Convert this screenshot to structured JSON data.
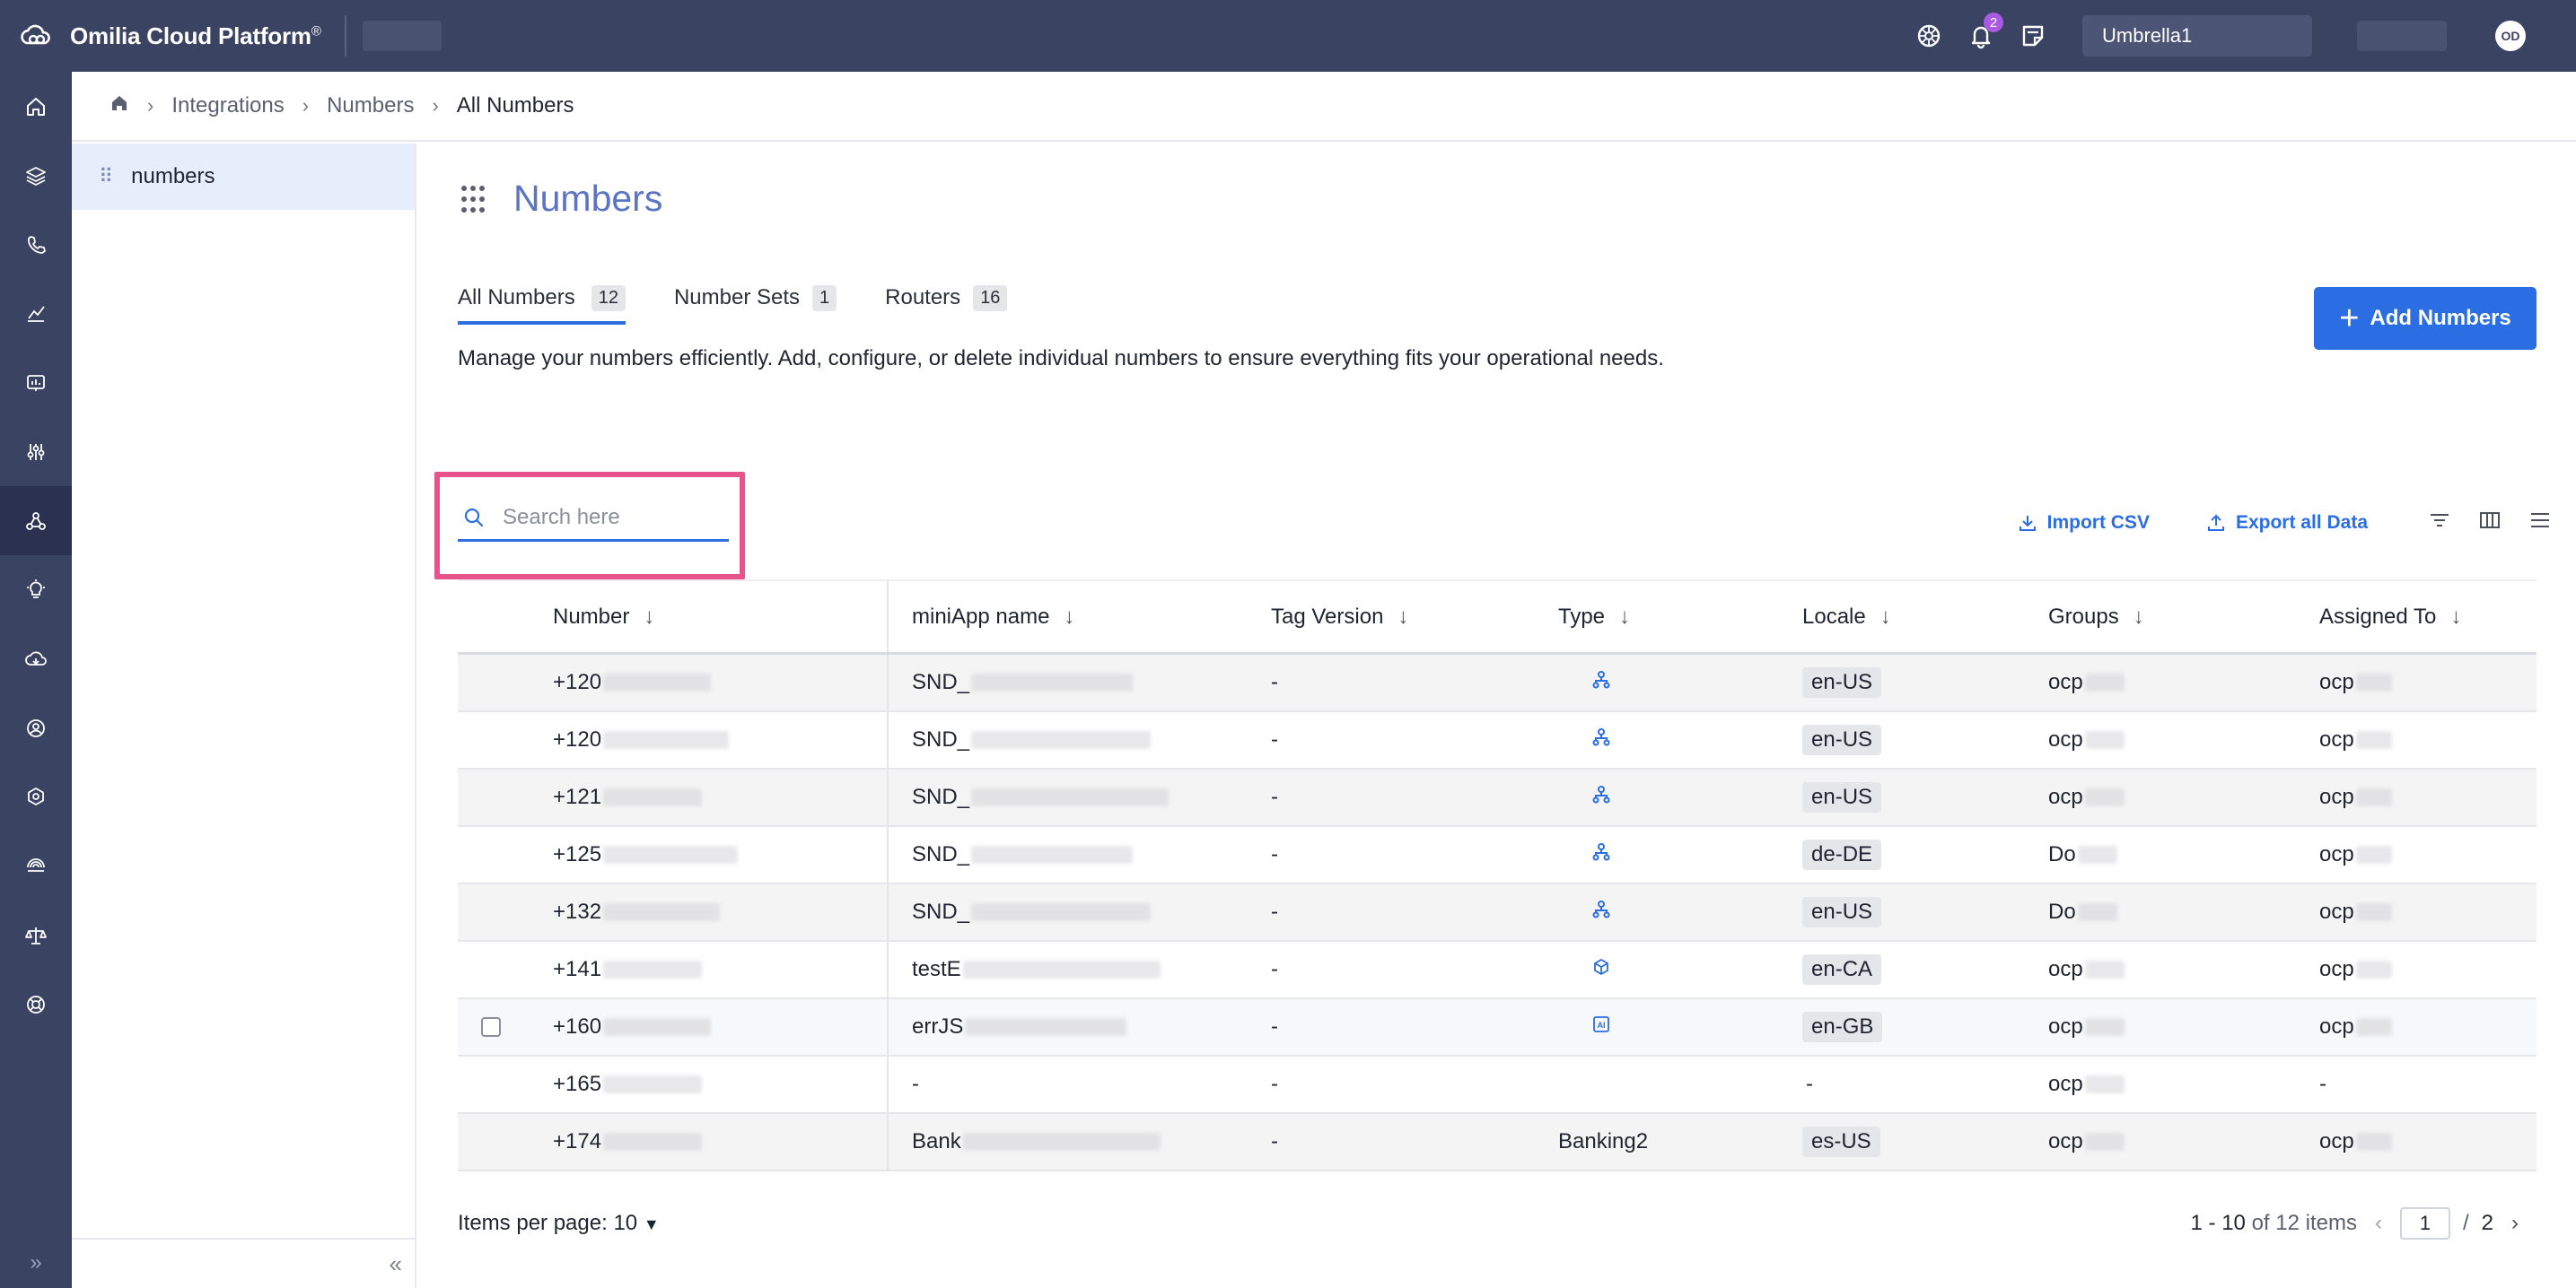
{
  "topbar": {
    "app_name": "Omilia Cloud Platform",
    "app_name_mark": "®",
    "notifications_count": "2",
    "org_selector_value": "Umbrella1",
    "avatar_initials": "OD"
  },
  "rail": {
    "icons": [
      "home-icon",
      "layers-icon",
      "phone-icon",
      "analytics-icon",
      "dashboard-icon",
      "sliders-icon",
      "integrations-icon",
      "insights-icon",
      "cloud-icon",
      "support-icon",
      "settings-icon",
      "biometrics-icon",
      "scales-icon",
      "help-icon"
    ],
    "active_index": 6,
    "expand_glyph": "»"
  },
  "breadcrumb": {
    "items": [
      "Integrations",
      "Numbers"
    ],
    "current": "All Numbers"
  },
  "subnav": {
    "item_label": "numbers",
    "collapse_glyph": "«"
  },
  "page": {
    "title": "Numbers",
    "description": "Manage your numbers efficiently. Add, configure, or delete individual numbers to ensure everything fits your operational needs.",
    "add_button": "Add Numbers"
  },
  "tabs": [
    {
      "label": "All Numbers",
      "count": "12",
      "active": true
    },
    {
      "label": "Number Sets",
      "count": "1",
      "active": false
    },
    {
      "label": "Routers",
      "count": "16",
      "active": false
    }
  ],
  "search": {
    "placeholder": "Search here",
    "value": ""
  },
  "toolbar": {
    "import_label": "Import CSV",
    "export_label": "Export all Data"
  },
  "table": {
    "columns": [
      "Number",
      "miniApp name",
      "Tag Version",
      "Type",
      "Locale",
      "Groups",
      "Assigned To"
    ],
    "rows": [
      {
        "number": "+120",
        "app": "SND_",
        "tag": "-",
        "type_icon": "flow-icon",
        "type_text": "",
        "locale": "en-US",
        "group": "ocp",
        "assigned": "ocp",
        "checkbox": false
      },
      {
        "number": "+120",
        "app": "SND_",
        "tag": "-",
        "type_icon": "flow-icon",
        "type_text": "",
        "locale": "en-US",
        "group": "ocp",
        "assigned": "ocp",
        "checkbox": false
      },
      {
        "number": "+121",
        "app": "SND_",
        "tag": "-",
        "type_icon": "flow-icon",
        "type_text": "",
        "locale": "en-US",
        "group": "ocp",
        "assigned": "ocp",
        "checkbox": false
      },
      {
        "number": "+125",
        "app": "SND_",
        "tag": "-",
        "type_icon": "flow-icon",
        "type_text": "",
        "locale": "de-DE",
        "group": "Do",
        "assigned": "ocp",
        "checkbox": false
      },
      {
        "number": "+132",
        "app": "SND_",
        "tag": "-",
        "type_icon": "flow-icon",
        "type_text": "",
        "locale": "en-US",
        "group": "Do",
        "assigned": "ocp",
        "checkbox": false
      },
      {
        "number": "+141",
        "app": "testE",
        "tag": "-",
        "type_icon": "cube-icon",
        "type_text": "",
        "locale": "en-CA",
        "group": "ocp",
        "assigned": "ocp",
        "checkbox": false
      },
      {
        "number": "+160",
        "app": "errJS",
        "tag": "-",
        "type_icon": "ai-icon",
        "type_text": "",
        "locale": "en-GB",
        "group": "ocp",
        "assigned": "ocp",
        "checkbox": true
      },
      {
        "number": "+165",
        "app": "-",
        "tag": "-",
        "type_icon": "",
        "type_text": "",
        "locale": "-",
        "group": "ocp",
        "assigned": "-",
        "checkbox": false
      },
      {
        "number": "+174",
        "app": "Bank",
        "tag": "-",
        "type_icon": "",
        "type_text": "Banking2",
        "locale": "es-US",
        "group": "ocp",
        "assigned": "ocp",
        "checkbox": false
      }
    ]
  },
  "pagination": {
    "items_per_page_label": "Items per page:",
    "items_per_page_value": "10",
    "range_text": "1 - 10",
    "range_suffix": "of 12 items",
    "current_page": "1",
    "total_pages": "2"
  },
  "colors": {
    "topbar": "#3b4363",
    "accent": "#2b6de3",
    "title": "#5b74c5",
    "highlight": "#e6548b"
  }
}
